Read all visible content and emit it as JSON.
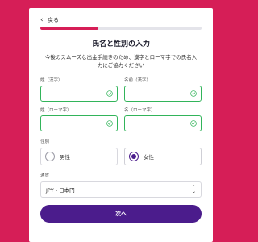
{
  "nav": {
    "back_label": "戻る"
  },
  "progress": {
    "value_percent": 36
  },
  "form": {
    "title": "氏名と性別の入力",
    "description": "今後のスムーズな出金手続きのため、漢字とローマ字での氏名入力にご協力ください",
    "fields": [
      {
        "label": "姓（漢字）",
        "value": ""
      },
      {
        "label": "名前（漢字）",
        "value": ""
      },
      {
        "label": "姓（ローマ字）",
        "value": ""
      },
      {
        "label": "名（ローマ字）",
        "value": ""
      }
    ],
    "gender": {
      "label": "性別",
      "options": [
        {
          "label": "男性",
          "selected": false
        },
        {
          "label": "女性",
          "selected": true
        }
      ]
    },
    "currency": {
      "label": "通貨",
      "selected": "JPY - 日本円"
    },
    "next_label": "次へ"
  },
  "colors": {
    "background": "#d61e57",
    "accent": "#4b1c8c",
    "valid": "#32b45a"
  },
  "icons": {
    "back": "chevron-left-icon",
    "valid": "check-circle-icon",
    "select": "chevron-up-down-icon"
  }
}
